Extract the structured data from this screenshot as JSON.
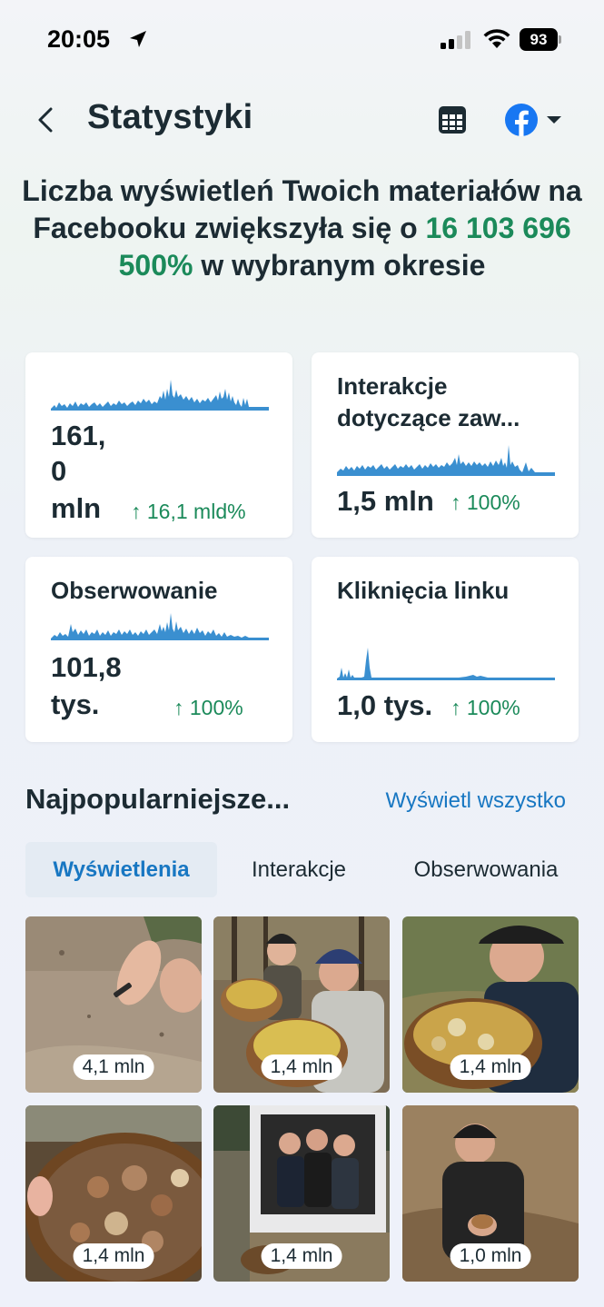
{
  "status_bar": {
    "time": "20:05",
    "battery": "93",
    "icons": [
      "location-arrow-icon",
      "signal-icon",
      "wifi-icon",
      "battery-icon"
    ]
  },
  "header": {
    "title": "Statystyki",
    "icons": [
      "chevron-left-icon",
      "table-icon",
      "facebook-icon",
      "caret-down-icon"
    ]
  },
  "headline": {
    "part1": "Liczba wyświetleń Twoich materiałów na Facebooku zwiększyła się o ",
    "highlight": "16 103 696 500%",
    "part2": " w wybranym okresie"
  },
  "metrics": [
    {
      "title": "",
      "value_line1": "161,",
      "value_line2": "0",
      "value_line3": "mln",
      "change": "16,1 mld%"
    },
    {
      "title_line1": "Interakcje",
      "title_line2": "dotyczące zaw...",
      "value": "1,5 mln",
      "change": "100%"
    },
    {
      "title": "Obserwowanie",
      "value_line1": "101,8",
      "value_line2": "tys.",
      "change": "100%"
    },
    {
      "title": "Kliknięcia linku",
      "value": "1,0 tys.",
      "change": "100%"
    }
  ],
  "top_content": {
    "title": "Najpopularniejsze...",
    "view_all": "Wyświetl wszystko",
    "tabs": [
      {
        "label": "Wyświetlenia",
        "active": true
      },
      {
        "label": "Interakcje",
        "active": false
      },
      {
        "label": "Obserwowania",
        "active": false
      }
    ],
    "items": [
      {
        "views": "4,1 mln"
      },
      {
        "views": "1,4 mln"
      },
      {
        "views": "1,4 mln"
      },
      {
        "views": "1,4 mln"
      },
      {
        "views": "1,4 mln"
      },
      {
        "views": "1,0 mln"
      }
    ]
  },
  "colors": {
    "accent_blue": "#1877c2",
    "positive_green": "#1b8a5a",
    "spark_blue": "#3a8fd0",
    "facebook_blue": "#1877f2"
  }
}
